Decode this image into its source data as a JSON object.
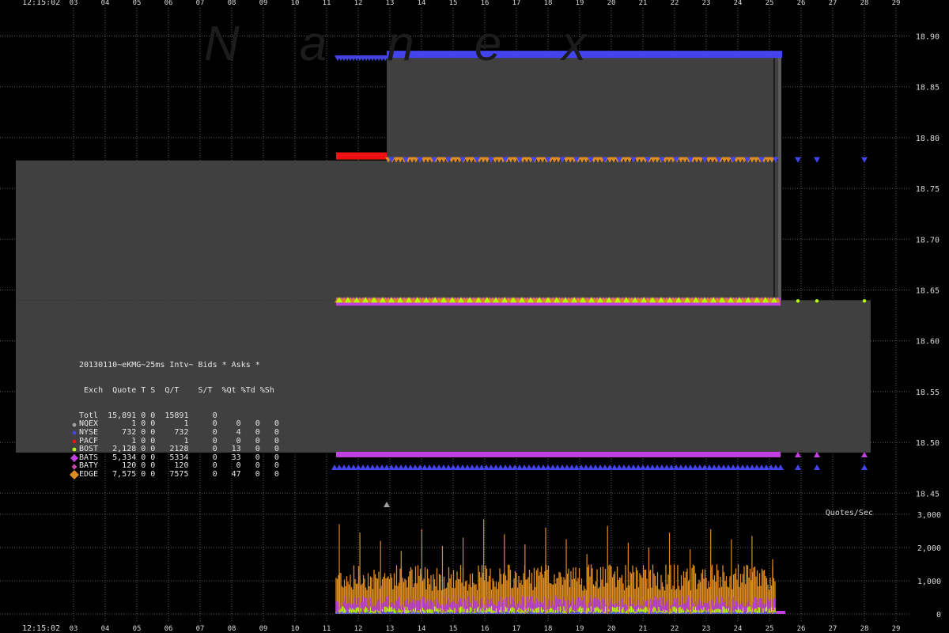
{
  "chart_data": {
    "type": "scatter",
    "title": "",
    "watermark": "Nanex",
    "time_label": "12:15:02",
    "x_tick_labels": [
      "03",
      "04",
      "05",
      "06",
      "07",
      "08",
      "09",
      "10",
      "11",
      "12",
      "13",
      "14",
      "15",
      "16",
      "17",
      "18",
      "19",
      "20",
      "21",
      "22",
      "23",
      "24",
      "25",
      "26",
      "27",
      "28",
      "29"
    ],
    "price_axis": {
      "ylim": [
        18.45,
        18.9
      ],
      "tick_labels": [
        "18.90",
        "18.85",
        "18.80",
        "18.75",
        "18.70",
        "18.65",
        "18.60",
        "18.55",
        "18.50",
        "18.45"
      ]
    },
    "volume_axis": {
      "label": "Quotes/Sec",
      "ylim": [
        0,
        3000
      ],
      "tick_labels": [
        "3,000",
        "2,000",
        "1,000",
        "0"
      ]
    },
    "nbbo": {
      "ask_high": 18.88,
      "ask_low": 18.78,
      "bid_high": 18.64,
      "bid_low": 18.49,
      "ask_high_from": 12.9,
      "ask_low_from": 11.3,
      "bid_high_from": 11.3,
      "nbbo_end": 25.3,
      "bid_low_from": 3.2,
      "bid_low_to": 28.2
    },
    "colors": {
      "background": "#000000",
      "grid": "#5a5a5a",
      "spread_fill": "#404040",
      "NQEX": "#a0a0a0",
      "NYSE": "#4444ee",
      "PACF": "#ee1111",
      "BOST": "#b4ff00",
      "BATS": "#c040e0",
      "BATY": "#cc44aa",
      "EDGE": "#dd8c22"
    },
    "legend": {
      "header_line": "20130110~eKMG~25ms Intv~ Bids * Asks *",
      "columns_line": " Exch  Quote T S  Q/T    S/T  %Qt %Td %Sh",
      "rows": [
        {
          "exch": "Totl",
          "quote": "15,891",
          "t": "0",
          "s": "0",
          "qt": "15891",
          "st": "0",
          "pqt": "",
          "ptd": "",
          "psh": "",
          "marker": "none"
        },
        {
          "exch": "NQEX",
          "quote": "1",
          "t": "0",
          "s": "0",
          "qt": "1",
          "st": "0",
          "pqt": "0",
          "ptd": "0",
          "psh": "0",
          "marker": "circle"
        },
        {
          "exch": "NYSE",
          "quote": "732",
          "t": "0",
          "s": "0",
          "qt": "732",
          "st": "0",
          "pqt": "4",
          "ptd": "0",
          "psh": "0",
          "marker": "circle"
        },
        {
          "exch": "PACF",
          "quote": "1",
          "t": "0",
          "s": "0",
          "qt": "1",
          "st": "0",
          "pqt": "0",
          "ptd": "0",
          "psh": "0",
          "marker": "circle"
        },
        {
          "exch": "BOST",
          "quote": "2,128",
          "t": "0",
          "s": "0",
          "qt": "2128",
          "st": "0",
          "pqt": "13",
          "ptd": "0",
          "psh": "0",
          "marker": "circle"
        },
        {
          "exch": "BATS",
          "quote": "5,334",
          "t": "0",
          "s": "0",
          "qt": "5334",
          "st": "0",
          "pqt": "33",
          "ptd": "0",
          "psh": "0",
          "marker": "diamond"
        },
        {
          "exch": "BATY",
          "quote": "120",
          "t": "0",
          "s": "0",
          "qt": "120",
          "st": "0",
          "pqt": "0",
          "ptd": "0",
          "psh": "0",
          "marker": "diamond-small"
        },
        {
          "exch": "EDGE",
          "quote": "7,575",
          "t": "0",
          "s": "0",
          "qt": "7575",
          "st": "0",
          "pqt": "47",
          "ptd": "0",
          "psh": "0",
          "marker": "diamond-big"
        }
      ]
    },
    "volume_spikes": [
      2700,
      2450,
      2200,
      1900,
      2550,
      2050,
      2300,
      2850,
      2400,
      2100,
      2600,
      2250,
      1800,
      2650,
      2150,
      2000,
      2450,
      1950,
      2550,
      2250,
      2350,
      1650
    ]
  }
}
